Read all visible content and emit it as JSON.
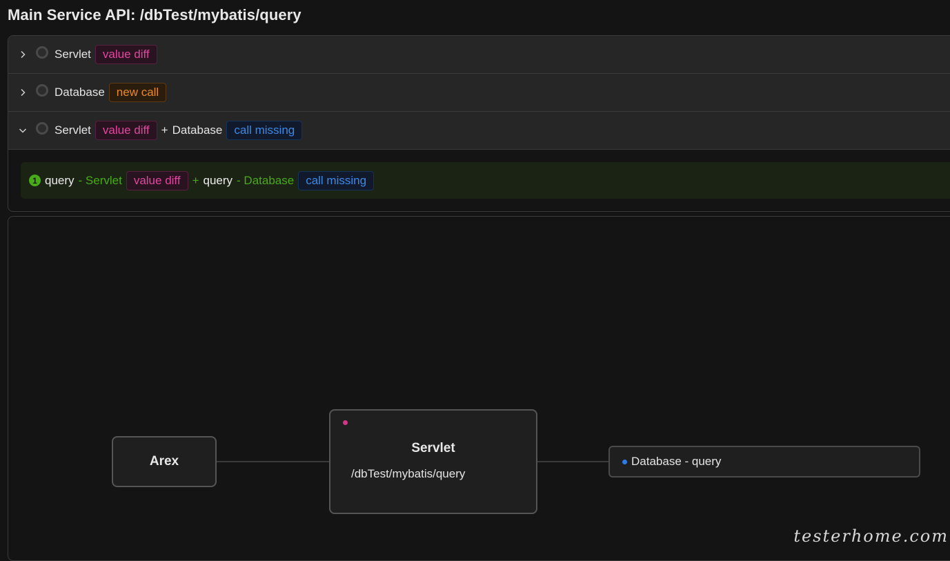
{
  "page_title": "Main Service API: /dbTest/mybatis/query",
  "issues": [
    {
      "label": "Servlet",
      "tag": "value diff",
      "expanded": false
    },
    {
      "label": "Database",
      "tag": "new call",
      "expanded": false
    },
    {
      "label": "Servlet",
      "tag": "value diff",
      "plus": "+",
      "label2": "Database",
      "tag2": "call missing",
      "expanded": true
    }
  ],
  "scene": {
    "index": "1",
    "op1": "query",
    "sep1": "- Servlet",
    "tag1": "value diff",
    "plus": "+",
    "op2": "query",
    "sep2": "- Database",
    "tag2": "call missing"
  },
  "flow": {
    "arex": "Arex",
    "servlet_title": "Servlet",
    "servlet_path": "/dbTest/mybatis/query",
    "db_node": "Database - query"
  },
  "watermark": "testerhome.com",
  "colors": {
    "value_diff": "#e0479e",
    "new_call": "#e8892b",
    "call_missing": "#3c89e8",
    "success": "#49aa19"
  }
}
